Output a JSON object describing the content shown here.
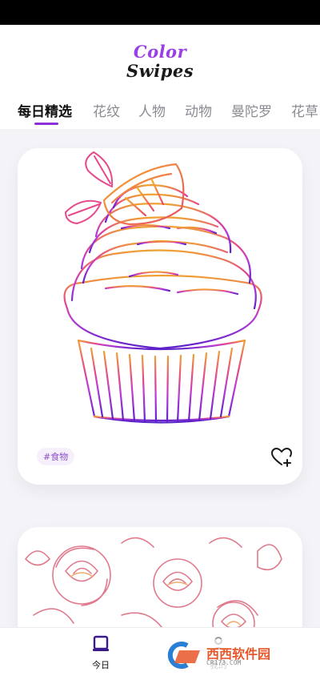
{
  "app": {
    "logo_line1": "Color",
    "logo_line2": "Swipes"
  },
  "tabs": [
    {
      "label": "每日精选",
      "active": true
    },
    {
      "label": "花纹",
      "active": false
    },
    {
      "label": "人物",
      "active": false
    },
    {
      "label": "动物",
      "active": false
    },
    {
      "label": "曼陀罗",
      "active": false
    },
    {
      "label": "花草",
      "active": false
    }
  ],
  "cards": [
    {
      "tag": "#食物",
      "icon": "heart-plus-icon",
      "subject": "cupcake"
    },
    {
      "subject": "roses"
    }
  ],
  "bottom_nav": {
    "today_label": "今日",
    "mine_label": "我的"
  },
  "watermark": {
    "brand": "西西软件园",
    "site": "CR173.COM"
  },
  "colors": {
    "accent": "#8d2fd8",
    "status_bar": "#000000"
  }
}
